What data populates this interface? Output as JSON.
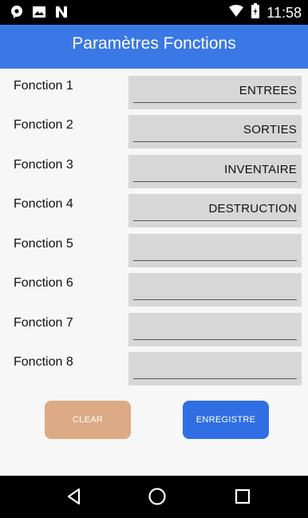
{
  "status_bar": {
    "time": "11:58",
    "icons": [
      "notification-icon",
      "image-icon",
      "n-icon",
      "wifi-icon",
      "battery-icon"
    ]
  },
  "header": {
    "title": "Paramètres Fonctions",
    "color": "#3a78e6"
  },
  "functions": [
    {
      "label": "Fonction 1",
      "value": "ENTREES"
    },
    {
      "label": "Fonction 2",
      "value": "SORTIES"
    },
    {
      "label": "Fonction 3",
      "value": "INVENTAIRE"
    },
    {
      "label": "Fonction 4",
      "value": "DESTRUCTION"
    },
    {
      "label": "Fonction 5",
      "value": ""
    },
    {
      "label": "Fonction 6",
      "value": ""
    },
    {
      "label": "Fonction 7",
      "value": ""
    },
    {
      "label": "Fonction 8",
      "value": ""
    }
  ],
  "buttons": {
    "clear_label": "CLEAR",
    "save_label": "ENREGISTRE",
    "clear_color": "#dcaa85",
    "save_color": "#2f6fe3"
  },
  "nav_bar": {
    "icons": [
      "back-icon",
      "home-icon",
      "recents-icon"
    ]
  }
}
